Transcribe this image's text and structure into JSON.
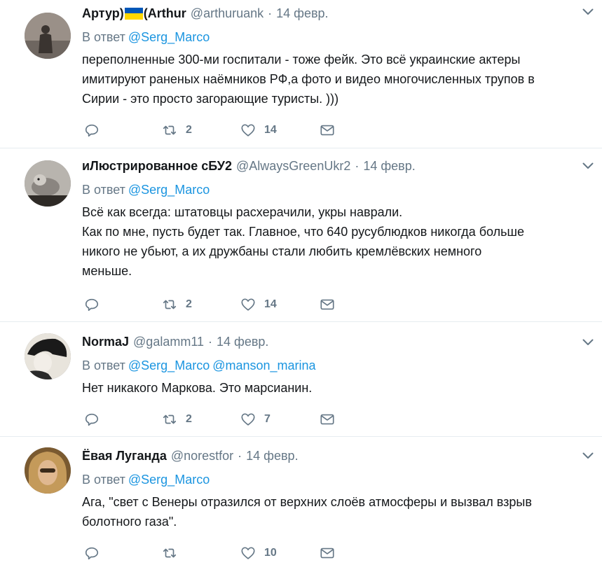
{
  "reply_prefix": "В ответ",
  "tweets": [
    {
      "name": "Артур)",
      "name_suffix": "(Arthur",
      "handle": "@arthuruank",
      "time": "14 февр.",
      "mentions": [
        "@Serg_Marco"
      ],
      "text": "переполненные 300-ми госпитали - тоже фейк. Это всё украинские актеры\nимитируют раненых наёмников РФ,а фото и видео многочисленных трупов в\nСирии - это просто загорающие туристы. )))",
      "retweets": "2",
      "likes": "14",
      "avatar_colors": [
        "#9a9088",
        "#3a3430"
      ]
    },
    {
      "name": "иЛюстрированное сБУ2",
      "handle": "@AlwaysGreenUkr2",
      "time": "14 февр.",
      "mentions": [
        "@Serg_Marco"
      ],
      "text": "Всё как всегда: штатовцы расхерачили, укры наврали.\nКак по мне, пусть будет так. Главное, что 640 русублюдков никогда больше\nникого не убьют, а их дружбаны стали любить кремлёвских немного\nменьше.",
      "retweets": "2",
      "likes": "14",
      "avatar_colors": [
        "#b8b4ae",
        "#2e2a26"
      ]
    },
    {
      "name": "NormaJ",
      "handle": "@galamm11",
      "time": "14 февр.",
      "mentions": [
        "@Serg_Marco",
        "@manson_marina"
      ],
      "text": "Нет никакого Маркова. Это марсианин.",
      "retweets": "2",
      "likes": "7",
      "avatar_colors": [
        "#e8e4dc",
        "#1a1a1a"
      ]
    },
    {
      "name": "Ёвая Луганда",
      "handle": "@norestfor",
      "time": "14 февр.",
      "mentions": [
        "@Serg_Marco"
      ],
      "text": "Ага, \"свет с Венеры отразился от верхних слоёв атмосферы и вызвал взрыв\nболотного газа\".",
      "retweets": "",
      "likes": "10",
      "avatar_colors": [
        "#c49a5a",
        "#5a3a20"
      ]
    }
  ],
  "colors": {
    "link": "#1b95e0",
    "muted": "#657786",
    "text": "#14171a",
    "divider": "#e6ecf0",
    "flag_blue": "#0057b8",
    "flag_yellow": "#ffd700"
  },
  "icons": [
    "reply-icon",
    "retweet-icon",
    "like-icon",
    "message-icon",
    "chevron-down-icon",
    "ukraine-flag-icon"
  ]
}
